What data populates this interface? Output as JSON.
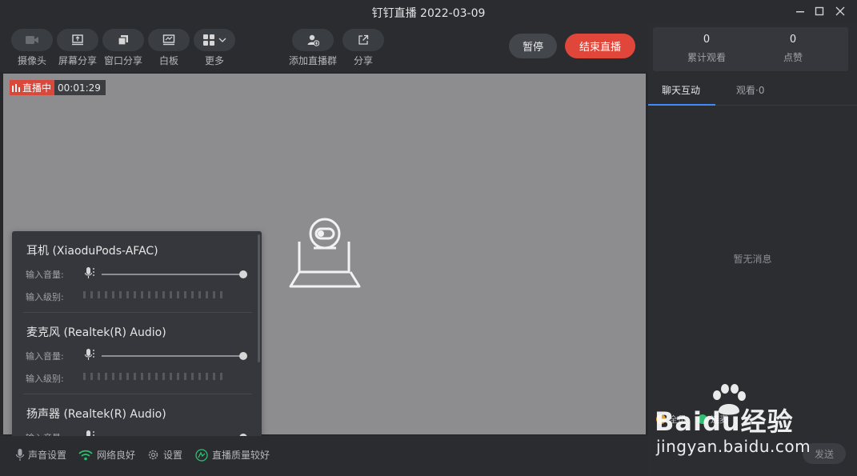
{
  "window": {
    "title": "钉钉直播 2022-03-09",
    "controls": {
      "minimize": "—",
      "maximize": "☐",
      "close": "✕"
    }
  },
  "toolbar": {
    "camera_label": "摄像头",
    "screen_share_label": "屏幕分享",
    "window_share_label": "窗口分享",
    "whiteboard_label": "白板",
    "more_label": "更多",
    "add_group_label": "添加直播群",
    "share_label": "分享",
    "pause_label": "暂停",
    "end_live_label": "结束直播"
  },
  "stage": {
    "live_tag": "直播中",
    "timer": "00:01:29"
  },
  "audio_devices": [
    {
      "name": "耳机 (XiaoduPods-AFAC)",
      "volume_label": "输入音量:",
      "level_label": "输入级别:",
      "volume": 1.0
    },
    {
      "name": "麦克风 (Realtek(R) Audio)",
      "volume_label": "输入音量:",
      "level_label": "输入级别:",
      "volume": 1.0
    },
    {
      "name": "扬声器 (Realtek(R) Audio)",
      "volume_label": "输入音量:",
      "level_label": "",
      "volume": 1.0
    }
  ],
  "statusbar": {
    "sound_settings": "声音设置",
    "network": "网络良好",
    "settings": "设置",
    "quality": "直播质量较好"
  },
  "right_panel": {
    "total_views": "0",
    "total_views_label": "累计观看",
    "likes": "0",
    "likes_label": "点赞",
    "tab_chat": "聊天互动",
    "tab_viewers": "观看·0",
    "empty_message": "暂无消息",
    "opt_1": "全员",
    "opt_2": "连麦",
    "send_label": "发送"
  },
  "watermark": {
    "logo": "Baidu经验",
    "url": "jingyan.baidu.com"
  },
  "colors": {
    "accent_red": "#e0473a",
    "tab_blue": "#3d8bfd",
    "stage_gray": "#8d8d8f",
    "network_green": "#2fbf71"
  }
}
